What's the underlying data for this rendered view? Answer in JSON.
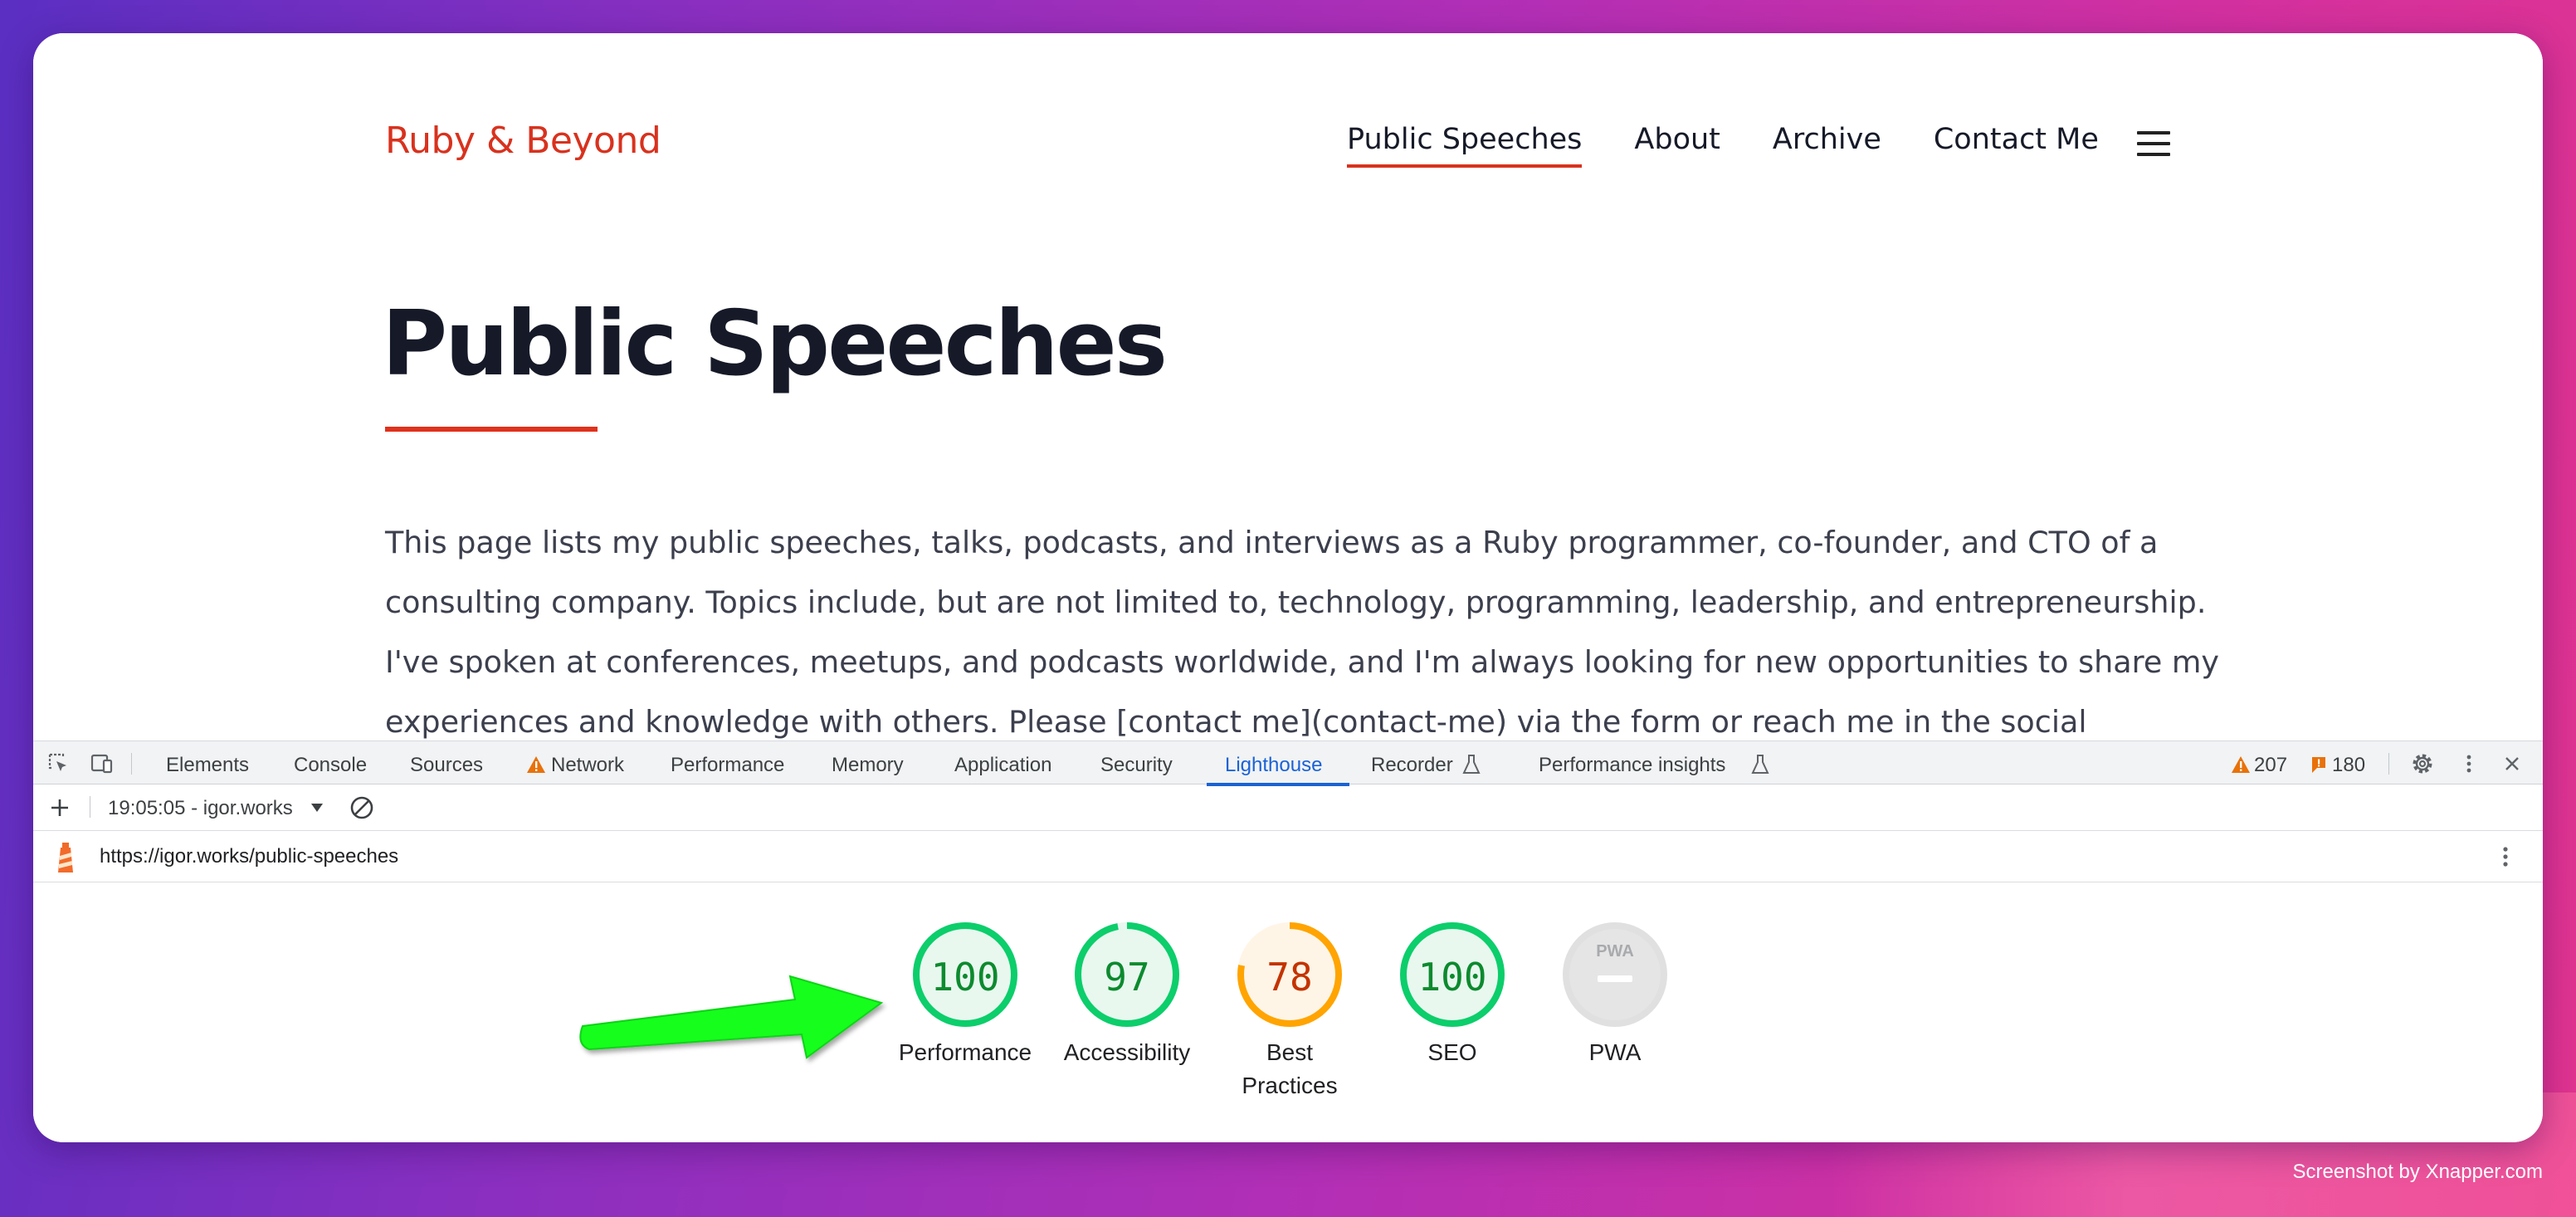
{
  "site": {
    "brand": "Ruby & Beyond",
    "nav": [
      {
        "label": "Public Speeches",
        "active": true
      },
      {
        "label": "About",
        "active": false
      },
      {
        "label": "Archive",
        "active": false
      },
      {
        "label": "Contact Me",
        "active": false
      }
    ],
    "menu_icon": "hamburger-menu-icon",
    "title": "Public Speeches",
    "intro": "This page lists my public speeches, talks, podcasts, and interviews as a Ruby programmer, co-founder, and CTO of a consulting company. Topics include, but are not limited to, technology, programming, leadership, and entrepreneurship. I've spoken at conferences, meetups, and podcasts worldwide, and I'm always looking for new opportunities to share my experiences and knowledge with others. Please [contact me](contact-me) via the form or reach me in the social networks."
  },
  "devtools": {
    "tabs": [
      "Elements",
      "Console",
      "Sources",
      "Network",
      "Performance",
      "Memory",
      "Application",
      "Security",
      "Lighthouse",
      "Recorder",
      "Performance insights"
    ],
    "active_tab": "Lighthouse",
    "warnings_count": "207",
    "issues_count": "180",
    "report_time": "19:05:05 - igor.works",
    "report_url": "https://igor.works/public-speeches",
    "scores": [
      {
        "label": "Performance",
        "value": "100",
        "score": 100,
        "color": "#0c8a2e",
        "ring": "#0cce6b",
        "fill": "#e8f8ef"
      },
      {
        "label": "Accessibility",
        "value": "97",
        "score": 97,
        "color": "#0c8a2e",
        "ring": "#0cce6b",
        "fill": "#e8f8ef"
      },
      {
        "label": "Best\nPractices",
        "value": "78",
        "score": 78,
        "color": "#c33300",
        "ring": "#ffa400",
        "fill": "#fff5e6"
      },
      {
        "label": "SEO",
        "value": "100",
        "score": 100,
        "color": "#0c8a2e",
        "ring": "#0cce6b",
        "fill": "#e8f8ef"
      },
      {
        "label": "PWA",
        "value": "",
        "score": 0,
        "color": "#9aa0a6",
        "ring": "#e0e0e0",
        "fill": "#e5e5e5"
      }
    ],
    "pwa_badge": "PWA"
  },
  "colors": {
    "brand": "#d8321e",
    "accent": "#1a62d6",
    "arrow": "#15ff1e"
  },
  "watermark": "Screenshot by Xnapper.com"
}
